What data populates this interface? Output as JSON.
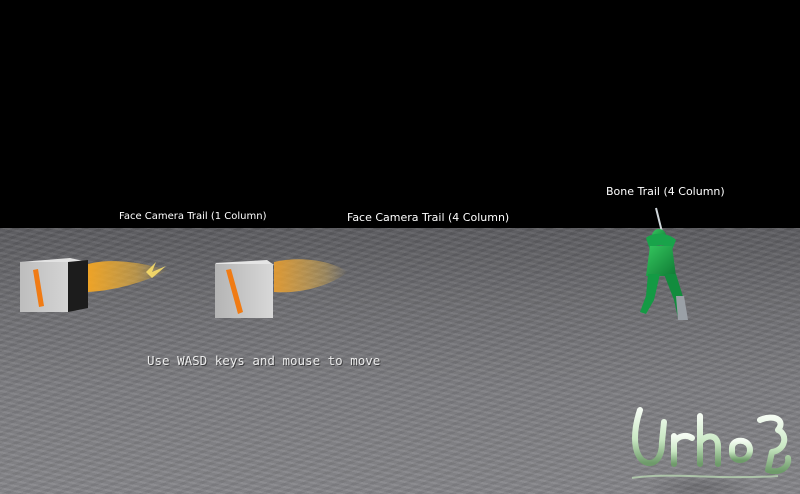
{
  "scene": {
    "labels": {
      "face_camera_1": "Face Camera Trail (1 Column)",
      "face_camera_4": "Face Camera Trail (4 Column)",
      "bone_trail": "Bone Trail (4 Column)"
    },
    "hint": "Use WASD keys and mouse to move"
  },
  "logo": {
    "text": "Urho3D",
    "icon": "urho3d-logo-icon"
  },
  "colors": {
    "sky": "#000000",
    "ground": "#7a7a7e",
    "trail": "#f5a623",
    "trail_glow": "#ffd54a",
    "character": "#1aa64a",
    "box_light": "#c9c9c9",
    "box_dark": "#1c1c1c"
  }
}
